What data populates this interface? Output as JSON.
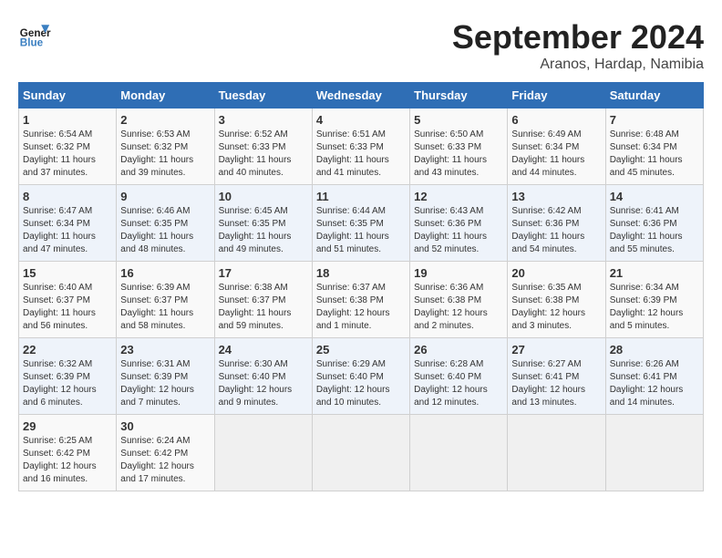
{
  "header": {
    "logo_line1": "General",
    "logo_line2": "Blue",
    "month": "September 2024",
    "location": "Aranos, Hardap, Namibia"
  },
  "weekdays": [
    "Sunday",
    "Monday",
    "Tuesday",
    "Wednesday",
    "Thursday",
    "Friday",
    "Saturday"
  ],
  "weeks": [
    [
      {
        "day": "1",
        "sunrise": "6:54 AM",
        "sunset": "6:32 PM",
        "daylight": "11 hours and 37 minutes."
      },
      {
        "day": "2",
        "sunrise": "6:53 AM",
        "sunset": "6:32 PM",
        "daylight": "11 hours and 39 minutes."
      },
      {
        "day": "3",
        "sunrise": "6:52 AM",
        "sunset": "6:33 PM",
        "daylight": "11 hours and 40 minutes."
      },
      {
        "day": "4",
        "sunrise": "6:51 AM",
        "sunset": "6:33 PM",
        "daylight": "11 hours and 41 minutes."
      },
      {
        "day": "5",
        "sunrise": "6:50 AM",
        "sunset": "6:33 PM",
        "daylight": "11 hours and 43 minutes."
      },
      {
        "day": "6",
        "sunrise": "6:49 AM",
        "sunset": "6:34 PM",
        "daylight": "11 hours and 44 minutes."
      },
      {
        "day": "7",
        "sunrise": "6:48 AM",
        "sunset": "6:34 PM",
        "daylight": "11 hours and 45 minutes."
      }
    ],
    [
      {
        "day": "8",
        "sunrise": "6:47 AM",
        "sunset": "6:34 PM",
        "daylight": "11 hours and 47 minutes."
      },
      {
        "day": "9",
        "sunrise": "6:46 AM",
        "sunset": "6:35 PM",
        "daylight": "11 hours and 48 minutes."
      },
      {
        "day": "10",
        "sunrise": "6:45 AM",
        "sunset": "6:35 PM",
        "daylight": "11 hours and 49 minutes."
      },
      {
        "day": "11",
        "sunrise": "6:44 AM",
        "sunset": "6:35 PM",
        "daylight": "11 hours and 51 minutes."
      },
      {
        "day": "12",
        "sunrise": "6:43 AM",
        "sunset": "6:36 PM",
        "daylight": "11 hours and 52 minutes."
      },
      {
        "day": "13",
        "sunrise": "6:42 AM",
        "sunset": "6:36 PM",
        "daylight": "11 hours and 54 minutes."
      },
      {
        "day": "14",
        "sunrise": "6:41 AM",
        "sunset": "6:36 PM",
        "daylight": "11 hours and 55 minutes."
      }
    ],
    [
      {
        "day": "15",
        "sunrise": "6:40 AM",
        "sunset": "6:37 PM",
        "daylight": "11 hours and 56 minutes."
      },
      {
        "day": "16",
        "sunrise": "6:39 AM",
        "sunset": "6:37 PM",
        "daylight": "11 hours and 58 minutes."
      },
      {
        "day": "17",
        "sunrise": "6:38 AM",
        "sunset": "6:37 PM",
        "daylight": "11 hours and 59 minutes."
      },
      {
        "day": "18",
        "sunrise": "6:37 AM",
        "sunset": "6:38 PM",
        "daylight": "12 hours and 1 minute."
      },
      {
        "day": "19",
        "sunrise": "6:36 AM",
        "sunset": "6:38 PM",
        "daylight": "12 hours and 2 minutes."
      },
      {
        "day": "20",
        "sunrise": "6:35 AM",
        "sunset": "6:38 PM",
        "daylight": "12 hours and 3 minutes."
      },
      {
        "day": "21",
        "sunrise": "6:34 AM",
        "sunset": "6:39 PM",
        "daylight": "12 hours and 5 minutes."
      }
    ],
    [
      {
        "day": "22",
        "sunrise": "6:32 AM",
        "sunset": "6:39 PM",
        "daylight": "12 hours and 6 minutes."
      },
      {
        "day": "23",
        "sunrise": "6:31 AM",
        "sunset": "6:39 PM",
        "daylight": "12 hours and 7 minutes."
      },
      {
        "day": "24",
        "sunrise": "6:30 AM",
        "sunset": "6:40 PM",
        "daylight": "12 hours and 9 minutes."
      },
      {
        "day": "25",
        "sunrise": "6:29 AM",
        "sunset": "6:40 PM",
        "daylight": "12 hours and 10 minutes."
      },
      {
        "day": "26",
        "sunrise": "6:28 AM",
        "sunset": "6:40 PM",
        "daylight": "12 hours and 12 minutes."
      },
      {
        "day": "27",
        "sunrise": "6:27 AM",
        "sunset": "6:41 PM",
        "daylight": "12 hours and 13 minutes."
      },
      {
        "day": "28",
        "sunrise": "6:26 AM",
        "sunset": "6:41 PM",
        "daylight": "12 hours and 14 minutes."
      }
    ],
    [
      {
        "day": "29",
        "sunrise": "6:25 AM",
        "sunset": "6:42 PM",
        "daylight": "12 hours and 16 minutes."
      },
      {
        "day": "30",
        "sunrise": "6:24 AM",
        "sunset": "6:42 PM",
        "daylight": "12 hours and 17 minutes."
      },
      null,
      null,
      null,
      null,
      null
    ]
  ]
}
